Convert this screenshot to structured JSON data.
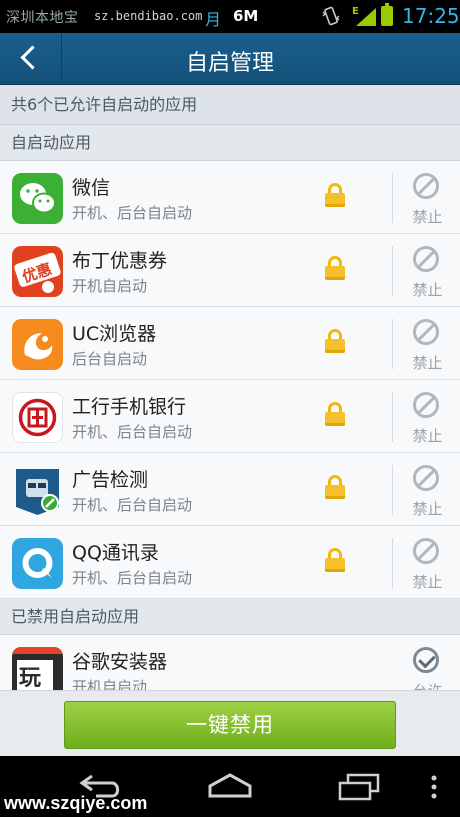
{
  "status_bar": {
    "watermark": "深圳本地宝",
    "watermark_url": "sz.bendibao.com",
    "moon_glyph": "月",
    "data_size": "6M",
    "network": "E",
    "time": "17:25"
  },
  "header": {
    "title": "自启管理"
  },
  "summary": "共6个已允许自启动的应用",
  "sections": {
    "allowed_title": "自启动应用",
    "disabled_title": "已禁用自启动应用"
  },
  "allowed_apps": [
    {
      "name": "微信",
      "desc": "开机、后台自启动",
      "action": "禁止",
      "icon": "wechat-icon"
    },
    {
      "name": "布丁优惠券",
      "desc": "开机自启动",
      "action": "禁止",
      "icon": "buding-coupon-icon"
    },
    {
      "name": "UC浏览器",
      "desc": "后台自启动",
      "action": "禁止",
      "icon": "uc-browser-icon"
    },
    {
      "name": "工行手机银行",
      "desc": "开机、后台自启动",
      "action": "禁止",
      "icon": "icbc-icon"
    },
    {
      "name": "广告检测",
      "desc": "开机、后台自启动",
      "action": "禁止",
      "icon": "ad-detector-icon"
    },
    {
      "name": "QQ通讯录",
      "desc": "开机、后台自启动",
      "action": "禁止",
      "icon": "qq-contacts-icon"
    }
  ],
  "disabled_apps": [
    {
      "name": "谷歌安装器",
      "desc": "开机自启动",
      "action": "允许",
      "icon": "google-installer-icon"
    }
  ],
  "footer": {
    "button_label": "一键禁用"
  },
  "navbar": {
    "site_watermark": "www.szqiye.com"
  },
  "colors": {
    "header_bg": "#135078",
    "accent_green": "#7ab828",
    "lock_yellow": "#f5c02b",
    "status_blue": "#33b5e5"
  }
}
